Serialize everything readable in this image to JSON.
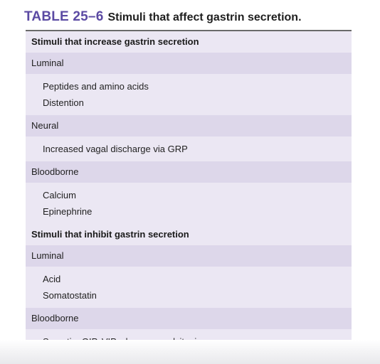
{
  "title": {
    "number": "TABLE 25–6",
    "caption": "Stimuli that affect gastrin secretion."
  },
  "sections": [
    {
      "heading": "Stimuli that increase gastrin secretion",
      "groups": [
        {
          "category": "Luminal",
          "items": [
            "Peptides and amino acids",
            "Distention"
          ]
        },
        {
          "category": "Neural",
          "items": [
            "Increased vagal discharge via GRP"
          ]
        },
        {
          "category": "Bloodborne",
          "items": [
            "Calcium",
            "Epinephrine"
          ]
        }
      ]
    },
    {
      "heading": "Stimuli that inhibit gastrin secretion",
      "groups": [
        {
          "category": "Luminal",
          "items": [
            "Acid",
            "Somatostatin"
          ]
        },
        {
          "category": "Bloodborne",
          "items": [
            "Secretin, GIP, VIP, glucagon, calcitonin"
          ]
        }
      ]
    }
  ]
}
